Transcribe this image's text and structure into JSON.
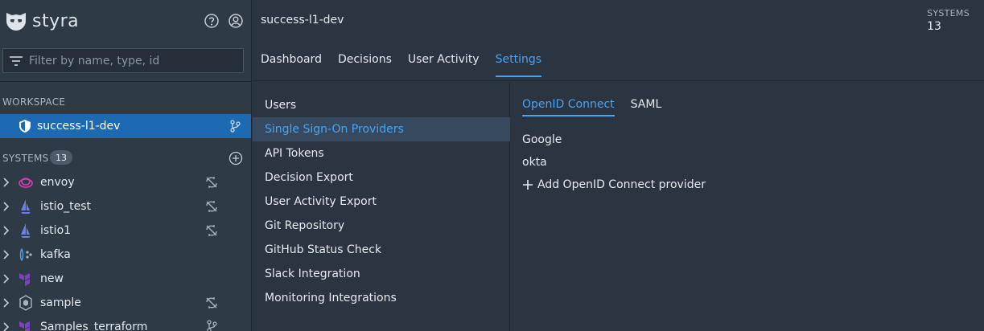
{
  "brand": {
    "name": "styra"
  },
  "header_icons": [
    "help-icon",
    "account-icon"
  ],
  "filter": {
    "placeholder": "Filter by name, type, id"
  },
  "workspace": {
    "section_label": "WORKSPACE",
    "item_label": "success-l1-dev"
  },
  "systems": {
    "section_label": "SYSTEMS",
    "count": "13",
    "items": [
      {
        "label": "envoy",
        "icon": "envoy-icon",
        "status_icon": "sync-disabled-icon"
      },
      {
        "label": "istio_test",
        "icon": "istio-icon",
        "status_icon": "sync-disabled-icon"
      },
      {
        "label": "istio1",
        "icon": "istio-icon",
        "status_icon": "sync-disabled-icon"
      },
      {
        "label": "kafka",
        "icon": "kafka-icon",
        "status_icon": ""
      },
      {
        "label": "new",
        "icon": "terraform-icon",
        "status_icon": ""
      },
      {
        "label": "sample",
        "icon": "kubernetes-icon",
        "status_icon": "sync-disabled-icon"
      },
      {
        "label": "Samples_terraform",
        "icon": "terraform-icon",
        "status_icon": "git-branch-icon"
      }
    ]
  },
  "main": {
    "title": "success-l1-dev",
    "systems_label": "SYSTEMS",
    "systems_value": "13",
    "tabs": [
      {
        "label": "Dashboard"
      },
      {
        "label": "Decisions"
      },
      {
        "label": "User Activity"
      },
      {
        "label": "Settings"
      }
    ],
    "active_tab": "Settings"
  },
  "settings_nav": {
    "items": [
      {
        "label": "Users"
      },
      {
        "label": "Single Sign-On Providers"
      },
      {
        "label": "API Tokens"
      },
      {
        "label": "Decision Export"
      },
      {
        "label": "User Activity Export"
      },
      {
        "label": "Git Repository"
      },
      {
        "label": "GitHub Status Check"
      },
      {
        "label": "Slack Integration"
      },
      {
        "label": "Monitoring Integrations"
      }
    ],
    "active": "Single Sign-On Providers"
  },
  "sso": {
    "tabs": [
      {
        "label": "OpenID Connect"
      },
      {
        "label": "SAML"
      }
    ],
    "active_tab": "OpenID Connect",
    "providers": [
      {
        "label": "Google"
      },
      {
        "label": "okta"
      }
    ],
    "add_label": "Add OpenID Connect provider"
  },
  "colors": {
    "accent": "#4aa3f0",
    "selected": "#1d6ab2",
    "sidebar_bg": "#2f3a47",
    "main_bg": "#2b3542"
  }
}
